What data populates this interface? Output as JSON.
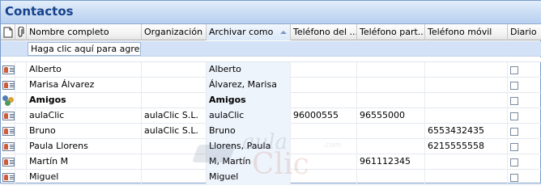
{
  "window": {
    "title": "Contactos"
  },
  "columns": {
    "icon": "",
    "attachment": "",
    "nombre": "Nombre completo",
    "organizacion": "Organización",
    "archivar": "Archivar como",
    "telefono": "Teléfono del ...",
    "telefono_part": "Teléfono part...",
    "movil": "Teléfono móvil",
    "diario": "Diario"
  },
  "new_row": {
    "placeholder": "Haga clic aquí para agre..."
  },
  "rows": [
    {
      "type": "contact",
      "nombre": "Alberto",
      "organizacion": "",
      "archivar": "Alberto",
      "telefono": "",
      "telefono_part": "",
      "movil": ""
    },
    {
      "type": "contact",
      "nombre": "Marisa Álvarez",
      "organizacion": "",
      "archivar": "Álvarez, Marisa",
      "telefono": "",
      "telefono_part": "",
      "movil": ""
    },
    {
      "type": "group",
      "nombre": "Amigos",
      "organizacion": "",
      "archivar": "Amigos",
      "telefono": "",
      "telefono_part": "",
      "movil": ""
    },
    {
      "type": "contact",
      "nombre": "aulaClic",
      "organizacion": "aulaClic S.L.",
      "archivar": "aulaClic",
      "telefono": "96000555",
      "telefono_part": "96555000",
      "movil": ""
    },
    {
      "type": "contact",
      "nombre": "Bruno",
      "organizacion": "aulaClic S.L.",
      "archivar": "Bruno",
      "telefono": "",
      "telefono_part": "",
      "movil": "6553432435"
    },
    {
      "type": "contact",
      "nombre": "Paula Llorens",
      "organizacion": "",
      "archivar": "Llorens, Paula",
      "telefono": "",
      "telefono_part": "",
      "movil": "6215555558"
    },
    {
      "type": "contact",
      "nombre": "Martín M",
      "organizacion": "",
      "archivar": "M, Martín",
      "telefono": "",
      "telefono_part": "961112345",
      "movil": ""
    },
    {
      "type": "contact",
      "nombre": "Miguel",
      "organizacion": "",
      "archivar": "Miguel",
      "telefono": "",
      "telefono_part": "",
      "movil": ""
    }
  ],
  "watermark": {
    "aula": "aula",
    "clic": "Clic",
    "com": ".com"
  },
  "icons": {
    "contact": "contact-card-icon",
    "group": "distribution-list-icon",
    "header_icon": "item-type-icon",
    "header_attachment": "paperclip-icon"
  },
  "colors": {
    "title": "#15428b",
    "titlebar": "#cddff5",
    "new_row": "#d3e2f6",
    "sorted_column": "#eef4fc"
  }
}
